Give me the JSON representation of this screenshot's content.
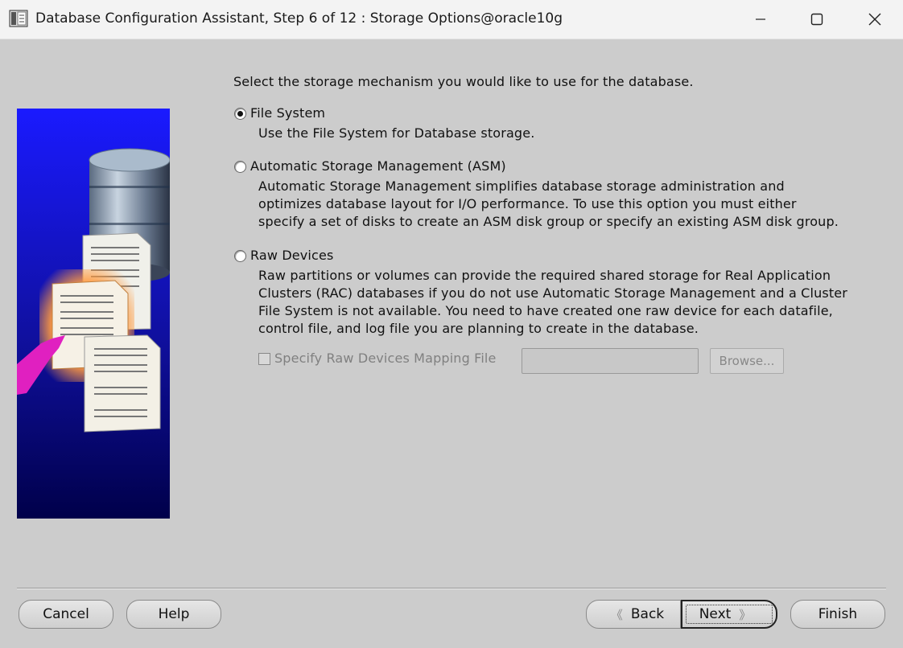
{
  "window": {
    "title": "Database Configuration Assistant, Step 6 of 12 : Storage Options@oracle10g"
  },
  "main": {
    "prompt": "Select the storage mechanism you would like to use for the database.",
    "options": [
      {
        "label": "File System",
        "selected": true,
        "description": [
          "Use the File System for Database storage."
        ]
      },
      {
        "label": "Automatic Storage Management (ASM)",
        "selected": false,
        "description": [
          "Automatic Storage Management simplifies database storage administration and",
          "optimizes database layout for I/O performance. To use this option you must either",
          "specify a set of disks to create an ASM disk group or specify an existing ASM disk group."
        ]
      },
      {
        "label": "Raw Devices",
        "selected": false,
        "description": [
          "Raw partitions or volumes can provide the required shared storage for Real Application",
          "Clusters (RAC) databases if you do not use Automatic Storage Management and a Cluster",
          "File System is not available.  You need to have created one raw device for each datafile,",
          "control file, and log file you are planning to create in the database."
        ]
      }
    ],
    "raw_mapping": {
      "checkbox_label": "Specify Raw Devices Mapping File",
      "checked": false,
      "enabled": false,
      "input_value": "",
      "browse_label": "Browse..."
    }
  },
  "footer": {
    "cancel": "Cancel",
    "help": "Help",
    "back": "Back",
    "next": "Next",
    "finish": "Finish"
  },
  "colors": {
    "background": "#cccccc",
    "art_blue_top": "#1a1aff",
    "art_blue_bottom": "#00004a",
    "arrow": "#e020c0"
  }
}
